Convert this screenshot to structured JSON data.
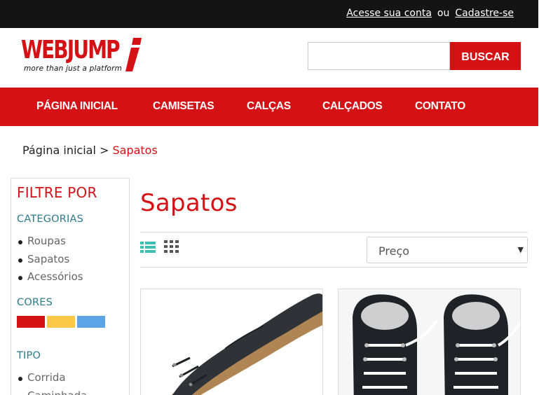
{
  "topbar": {
    "login_link": "Acesse sua conta",
    "or_text": "ou",
    "register_link": "Cadastre-se"
  },
  "header": {
    "logo_text_web": "WEB",
    "logo_text_jump": "JUMP",
    "logo_tagline": "more than just a platform",
    "search_placeholder": "",
    "search_button": "BUSCAR"
  },
  "nav": {
    "items": [
      {
        "label": "PÁGINA INICIAL"
      },
      {
        "label": "CAMISETAS"
      },
      {
        "label": "CALÇAS"
      },
      {
        "label": "CALÇADOS"
      },
      {
        "label": "CONTATO"
      }
    ]
  },
  "breadcrumb": {
    "home": "Página inicial",
    "separator": ">",
    "current": "Sapatos"
  },
  "sidebar": {
    "title": "FILTRE POR",
    "categories_title": "CATEGORIAS",
    "categories": [
      "Roupas",
      "Sapatos",
      "Acessórios"
    ],
    "colors_title": "CORES",
    "colors": [
      "#d41216",
      "#fcc847",
      "#5ca4e6"
    ],
    "type_title": "TIPO",
    "types": [
      "Corrida",
      "Caminhada"
    ]
  },
  "main": {
    "title": "Sapatos",
    "view_list_icon": "list-view-icon",
    "view_grid_icon": "grid-view-icon",
    "sort_label": "Preço"
  },
  "colors": {
    "brand_red": "#d41216",
    "topbar_bg": "#141414",
    "teal_accent": "#2c7a8c",
    "icon_teal": "#3fbfb4"
  }
}
